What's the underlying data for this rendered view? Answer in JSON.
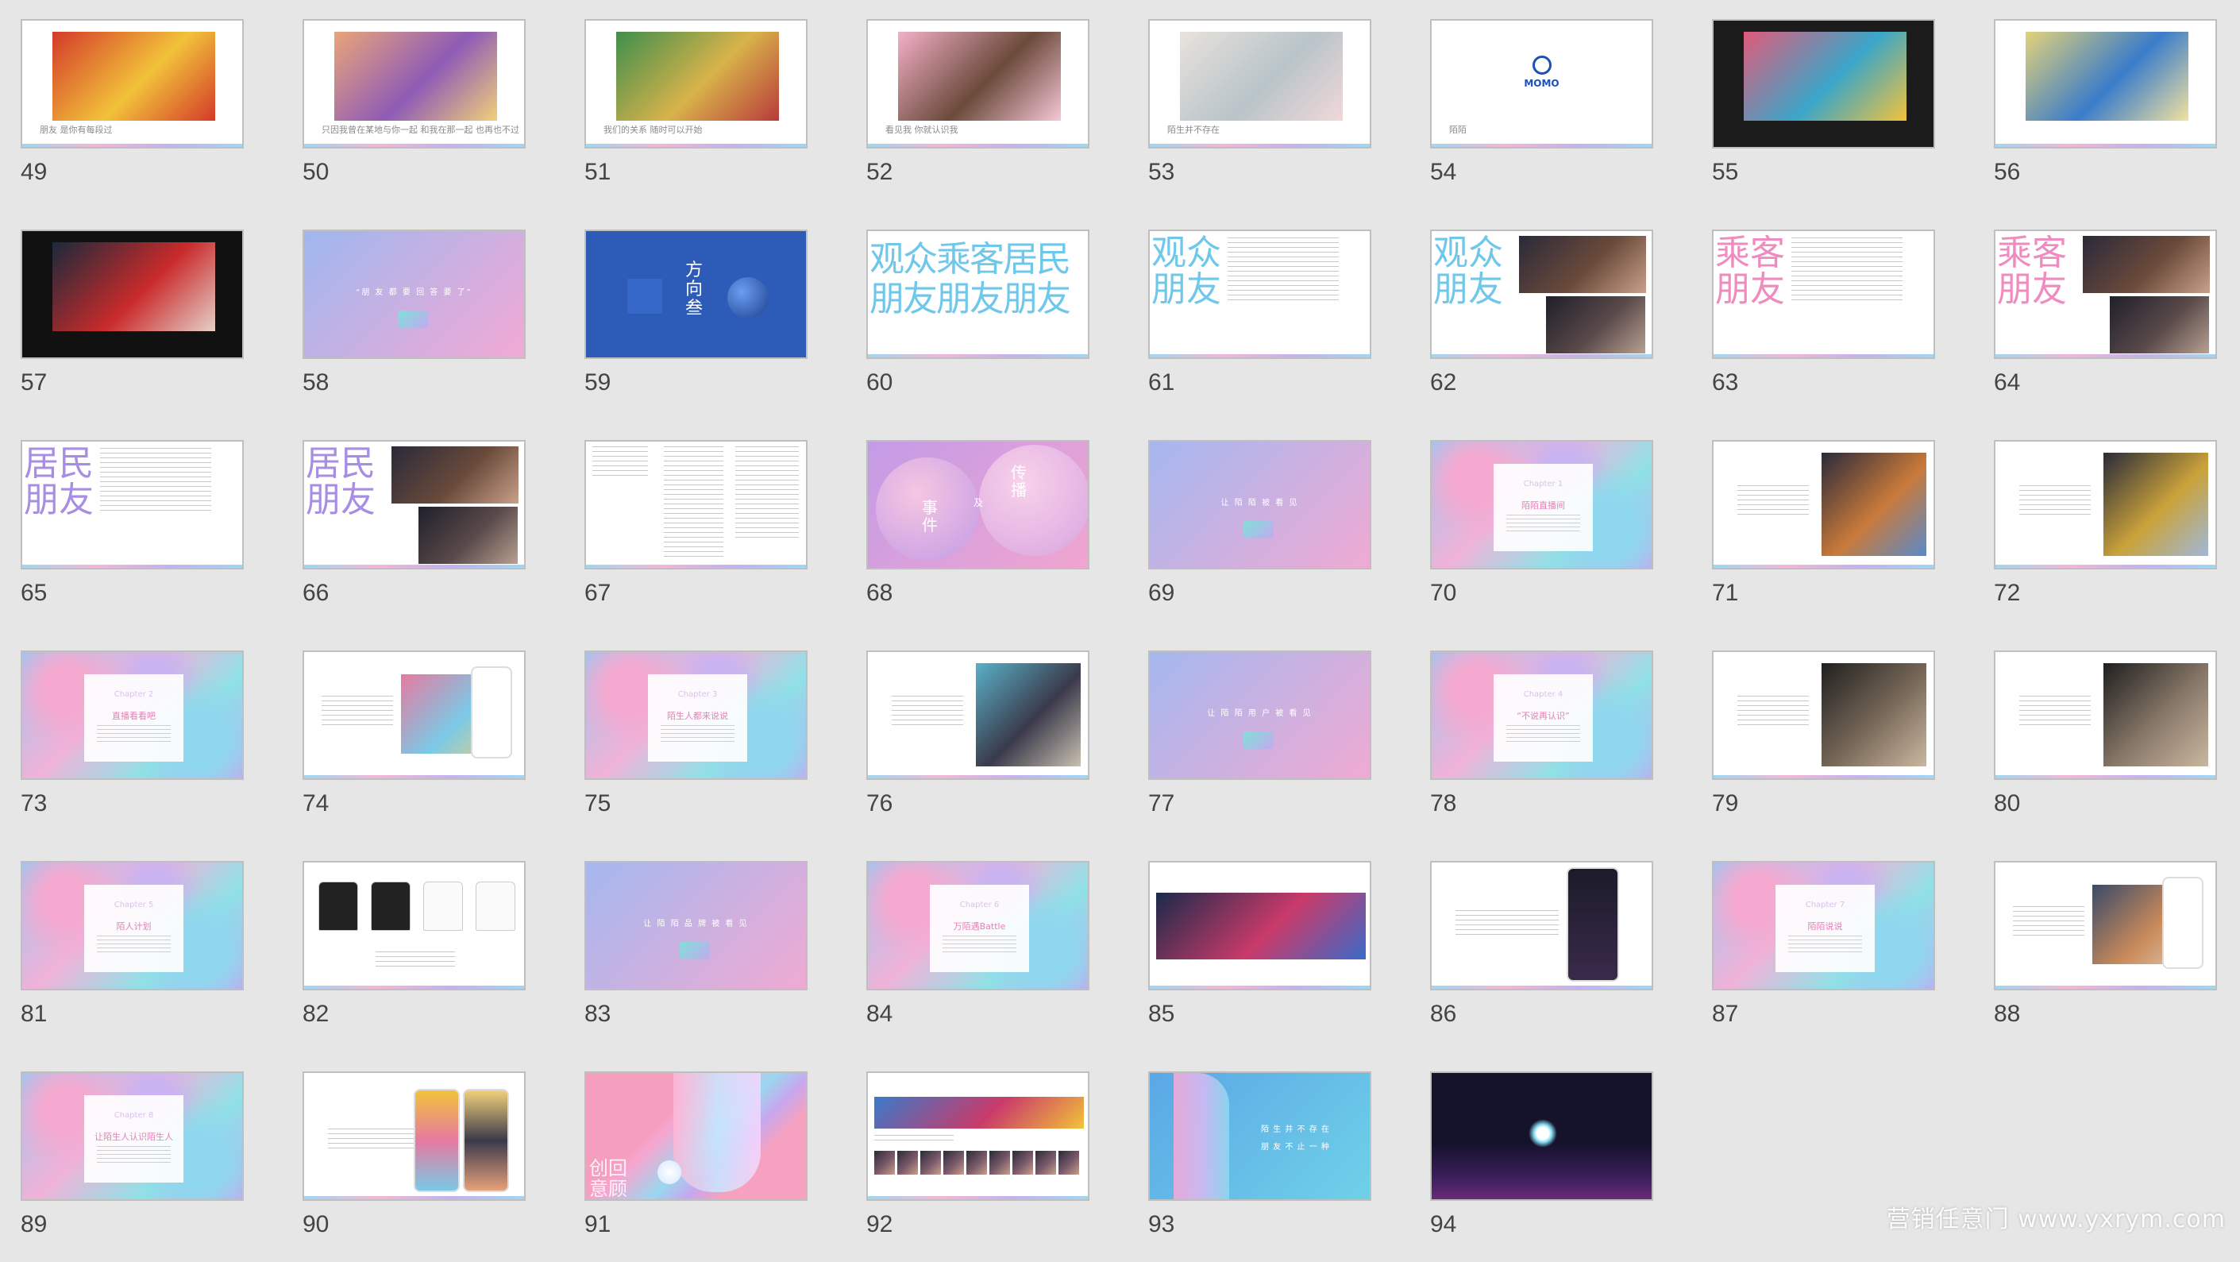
{
  "slides": [
    {
      "num": "49",
      "bg": "#ffffff",
      "caption": "朋友 是你有每段过",
      "type": "photo",
      "colors": [
        "#d43a2a",
        "#f2c23a",
        "#d43a2a"
      ]
    },
    {
      "num": "50",
      "bg": "#ffffff",
      "caption": "只因我曾在某地与你一起 和我在那一起 也再也不过",
      "type": "photo",
      "colors": [
        "#e9a57a",
        "#8e5bb6",
        "#f1d07a"
      ]
    },
    {
      "num": "51",
      "bg": "#ffffff",
      "caption": "我们的关系 随时可以开始",
      "type": "photo",
      "colors": [
        "#3f8f4c",
        "#d9b24b",
        "#b73a3a"
      ]
    },
    {
      "num": "52",
      "bg": "#ffffff",
      "caption": "看见我 你就认识我",
      "type": "photo",
      "colors": [
        "#f3b0c8",
        "#6b4a3a",
        "#f6c7d7"
      ]
    },
    {
      "num": "53",
      "bg": "#ffffff",
      "caption": "陌生并不存在",
      "type": "photo",
      "colors": [
        "#e8e2dc",
        "#b9c4c9",
        "#f0d8d8"
      ]
    },
    {
      "num": "54",
      "bg": "#ffffff",
      "caption": "陌陌",
      "type": "logo",
      "logo": "MOMO"
    },
    {
      "num": "55",
      "bg": "#1b1b1b",
      "type": "photo",
      "colors": [
        "#e05a7a",
        "#3aa6c9",
        "#f2c23a"
      ]
    },
    {
      "num": "56",
      "bg": "#ffffff",
      "type": "photo",
      "colors": [
        "#e3d27a",
        "#3a7cc9",
        "#f2e2a0"
      ]
    },
    {
      "num": "57",
      "bg": "#111111",
      "type": "photo",
      "colors": [
        "#1a2a3a",
        "#c92a2a",
        "#e6d0c8"
      ]
    },
    {
      "num": "58",
      "bg": "linear-gradient(135deg,#9fb7ef,#f2a9d5)",
      "caption": "“朋友都要回答”",
      "type": "gradient-text",
      "text": "“朋 友 都 要 回 答 要 了”"
    },
    {
      "num": "59",
      "bg": "#2d5bb8",
      "type": "vertical-title",
      "text": "方向叁"
    },
    {
      "num": "60",
      "bg": "#ffffff",
      "type": "big-chars",
      "lines": [
        "观众乘客居民",
        "朋友朋友朋友"
      ]
    },
    {
      "num": "61",
      "bg": "#ffffff",
      "type": "big-chars-text",
      "lines": [
        "观众",
        "朋友"
      ],
      "color": "#6fc7ea"
    },
    {
      "num": "62",
      "bg": "#ffffff",
      "type": "big-chars-photo",
      "lines": [
        "观众",
        "朋友"
      ],
      "color": "#6fc7ea"
    },
    {
      "num": "63",
      "bg": "#ffffff",
      "type": "big-chars-text",
      "lines": [
        "乘客",
        "朋友"
      ],
      "color": "#f08bbf"
    },
    {
      "num": "64",
      "bg": "#ffffff",
      "type": "big-chars-photo",
      "lines": [
        "乘客",
        "朋友"
      ],
      "color": "#f08bbf"
    },
    {
      "num": "65",
      "bg": "#ffffff",
      "type": "big-chars-text",
      "lines": [
        "居民",
        "朋友"
      ],
      "color": "#a88ee3"
    },
    {
      "num": "66",
      "bg": "#ffffff",
      "type": "big-chars-photo",
      "lines": [
        "居民",
        "朋友"
      ],
      "color": "#a88ee3"
    },
    {
      "num": "67",
      "bg": "#ffffff",
      "type": "text-columns"
    },
    {
      "num": "68",
      "bg": "linear-gradient(135deg,#c39be7,#f1a5cf)",
      "type": "event",
      "text": [
        "事件",
        "及",
        "传播"
      ]
    },
    {
      "num": "69",
      "bg": "linear-gradient(135deg,#a5b8ef,#efaad3)",
      "type": "gradient-text",
      "text": "让 陌 陌 被 看 见"
    },
    {
      "num": "70",
      "type": "marble-card",
      "card": [
        "Chapter 1",
        "陌陌直播间"
      ]
    },
    {
      "num": "71",
      "bg": "#ffffff",
      "type": "text-photo",
      "colors": [
        "#2a2a3a",
        "#c97a3a",
        "#5a8ac9"
      ]
    },
    {
      "num": "72",
      "bg": "#ffffff",
      "type": "text-photo",
      "colors": [
        "#2a2a3a",
        "#c9a23a",
        "#a0b8d9"
      ]
    },
    {
      "num": "73",
      "type": "marble-card",
      "card": [
        "Chapter 2",
        "直播看看吧"
      ]
    },
    {
      "num": "74",
      "bg": "#ffffff",
      "type": "text-photo-phone",
      "colors": [
        "#e67aa0",
        "#7ac9e6",
        "#f2d07a"
      ]
    },
    {
      "num": "75",
      "type": "marble-card",
      "card": [
        "Chapter 3",
        "陌生人都来说说"
      ]
    },
    {
      "num": "76",
      "bg": "#ffffff",
      "type": "text-photo",
      "colors": [
        "#5ab0c9",
        "#3a3a4a",
        "#c9c0b0"
      ]
    },
    {
      "num": "77",
      "bg": "linear-gradient(135deg,#a5b8ef,#efaad3)",
      "type": "gradient-text",
      "text": "让 陌 陌 用 户 被 看 见"
    },
    {
      "num": "78",
      "type": "marble-card",
      "card": [
        "Chapter 4",
        "“不说再认识”"
      ]
    },
    {
      "num": "79",
      "bg": "#ffffff",
      "type": "text-photo",
      "colors": [
        "#1f1f1f",
        "#7a6a5a",
        "#c9b8a0"
      ]
    },
    {
      "num": "80",
      "bg": "#ffffff",
      "type": "text-photo",
      "colors": [
        "#1f1f1f",
        "#8a7a6a",
        "#c9b8a0"
      ]
    },
    {
      "num": "81",
      "type": "marble-card",
      "card": [
        "Chapter 5",
        "陌人计划"
      ]
    },
    {
      "num": "82",
      "bg": "#ffffff",
      "type": "tshirts"
    },
    {
      "num": "83",
      "bg": "linear-gradient(135deg,#a5b8ef,#efaad3)",
      "type": "gradient-text",
      "text": "让 陌 陌 品 牌 被 看 见"
    },
    {
      "num": "84",
      "type": "marble-card",
      "card": [
        "Chapter 6",
        "万陌遇Battle"
      ]
    },
    {
      "num": "85",
      "bg": "#ffffff",
      "type": "banner",
      "colors": [
        "#1b2a4a",
        "#c93a6a",
        "#3a6ac9"
      ]
    },
    {
      "num": "86",
      "bg": "#ffffff",
      "type": "text-phone"
    },
    {
      "num": "87",
      "type": "marble-card",
      "card": [
        "Chapter 7",
        "陌陌说说"
      ]
    },
    {
      "num": "88",
      "bg": "#ffffff",
      "type": "text-photo-phone",
      "colors": [
        "#3a4a6a",
        "#c98a5a",
        "#e6d0c0"
      ]
    },
    {
      "num": "89",
      "type": "marble-card",
      "card": [
        "Chapter 8",
        "让陌生人认识陌生人"
      ]
    },
    {
      "num": "90",
      "bg": "#ffffff",
      "type": "text-phones"
    },
    {
      "num": "91",
      "bg": "#f6a1bf",
      "type": "holo",
      "text": [
        "创回",
        "意顾"
      ]
    },
    {
      "num": "92",
      "bg": "#ffffff",
      "type": "review-grid"
    },
    {
      "num": "93",
      "bg": "linear-gradient(135deg,#5aa7e6,#6fd1e8)",
      "type": "holo-text",
      "text": [
        "陌 生 并 不 存 在",
        "朋 友 不 止 一 种"
      ]
    },
    {
      "num": "94",
      "bg": "#15122b",
      "type": "dark-logo"
    }
  ],
  "watermark": "营销任意门 www.yxrym.com"
}
